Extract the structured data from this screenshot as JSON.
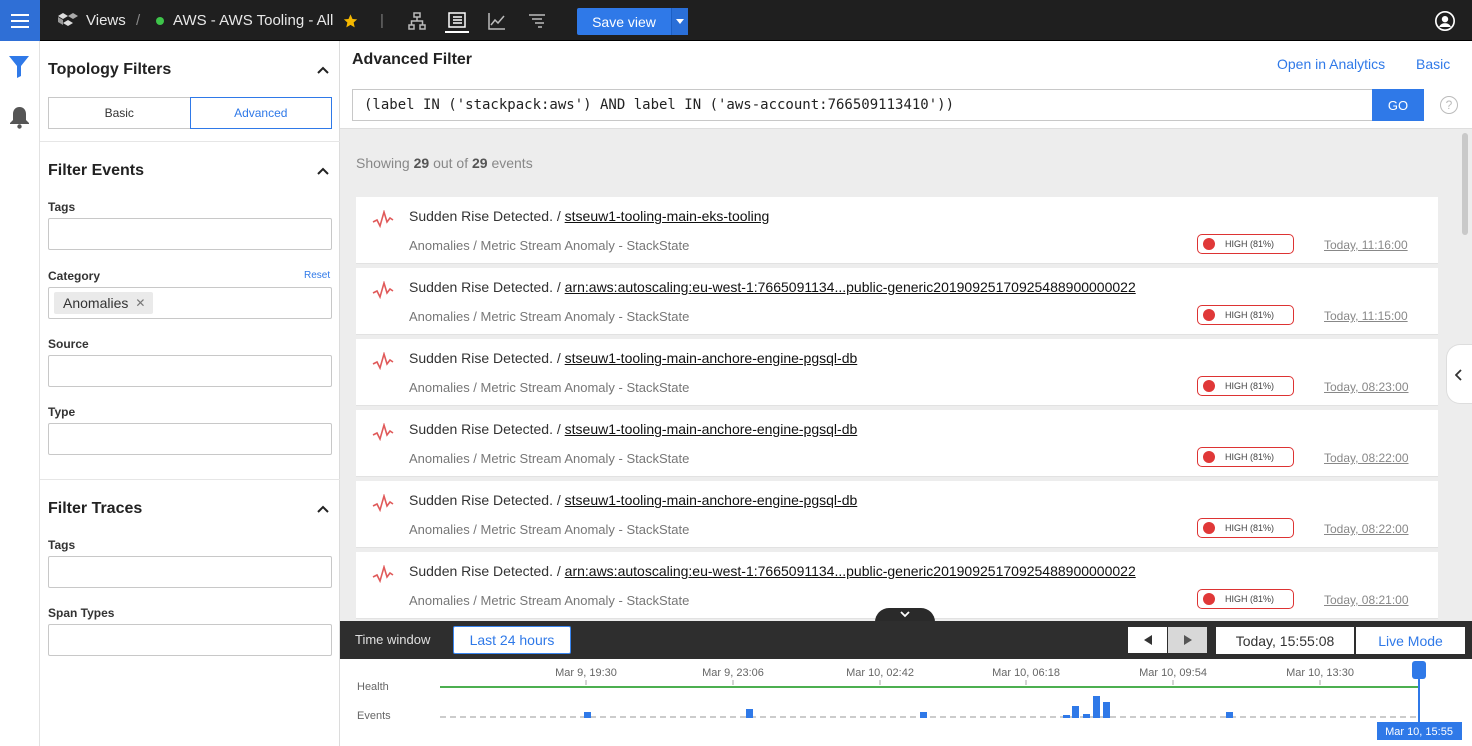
{
  "topbar": {
    "views_label": "Views",
    "view_name": "AWS - AWS Tooling - All",
    "save_label": "Save view"
  },
  "sidebar": {
    "topology_title": "Topology Filters",
    "basic_label": "Basic",
    "advanced_label": "Advanced",
    "events_title": "Filter Events",
    "tags_label": "Tags",
    "category_label": "Category",
    "reset_label": "Reset",
    "category_chip": "Anomalies",
    "source_label": "Source",
    "type_label": "Type",
    "traces_title": "Filter Traces",
    "trace_tags_label": "Tags",
    "span_types_label": "Span Types"
  },
  "main": {
    "title": "Advanced Filter",
    "open_analytics": "Open in Analytics",
    "basic_link": "Basic",
    "query": "(label IN ('stackpack:aws') AND label IN ('aws-account:766509113410'))",
    "go_label": "GO",
    "showing_prefix": "Showing",
    "showing_count": "29",
    "showing_mid": "out of",
    "showing_total": "29",
    "showing_suffix": "events"
  },
  "events": [
    {
      "title": "Sudden Rise Detected. /",
      "link": "stseuw1-tooling-main-eks-tooling",
      "sub": "Anomalies / Metric Stream Anomaly - StackState",
      "badge": "HIGH (81%)",
      "time": "Today, 11:16:00"
    },
    {
      "title": "Sudden Rise Detected. /",
      "link": "arn:aws:autoscaling:eu-west-1:7665091134...public-generic20190925170925488900000022",
      "sub": "Anomalies / Metric Stream Anomaly - StackState",
      "badge": "HIGH (81%)",
      "time": "Today, 11:15:00"
    },
    {
      "title": "Sudden Rise Detected. /",
      "link": "stseuw1-tooling-main-anchore-engine-pgsql-db",
      "sub": "Anomalies / Metric Stream Anomaly - StackState",
      "badge": "HIGH (81%)",
      "time": "Today, 08:23:00"
    },
    {
      "title": "Sudden Rise Detected. /",
      "link": "stseuw1-tooling-main-anchore-engine-pgsql-db",
      "sub": "Anomalies / Metric Stream Anomaly - StackState",
      "badge": "HIGH (81%)",
      "time": "Today, 08:22:00"
    },
    {
      "title": "Sudden Rise Detected. /",
      "link": "stseuw1-tooling-main-anchore-engine-pgsql-db",
      "sub": "Anomalies / Metric Stream Anomaly - StackState",
      "badge": "HIGH (81%)",
      "time": "Today, 08:22:00"
    },
    {
      "title": "Sudden Rise Detected. /",
      "link": "arn:aws:autoscaling:eu-west-1:7665091134...public-generic20190925170925488900000022",
      "sub": "Anomalies / Metric Stream Anomaly - StackState",
      "badge": "HIGH (81%)",
      "time": "Today, 08:21:00"
    }
  ],
  "timebar": {
    "label": "Time window",
    "range": "Last 24 hours",
    "now": "Today, 15:55:08",
    "live": "Live Mode"
  },
  "timeline": {
    "health_label": "Health",
    "events_label": "Events",
    "ticks": [
      "Mar 9, 19:30",
      "Mar 9, 23:06",
      "Mar 10, 02:42",
      "Mar 10, 06:18",
      "Mar 10, 09:54",
      "Mar 10, 13:30"
    ],
    "cursor": "Mar 10, 15:55"
  },
  "colors": {
    "accent": "#2f79e8",
    "health": "#4caf50",
    "critical": "#e03838"
  }
}
